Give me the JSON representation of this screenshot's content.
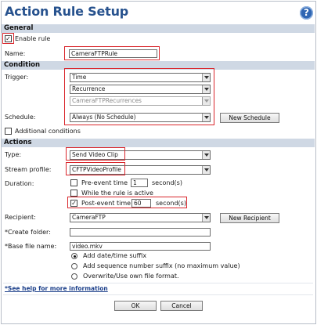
{
  "header": {
    "title": "Action Rule Setup",
    "help_glyph": "?"
  },
  "general": {
    "section_label": "General",
    "enable_rule_label": "Enable rule",
    "enable_rule_checked": true,
    "name_label": "Name:",
    "name_value": "CameraFTPRule"
  },
  "condition": {
    "section_label": "Condition",
    "trigger_label": "Trigger:",
    "trigger_value": "Time",
    "trigger_sub_value": "Recurrence",
    "recurrence_value": "CameraFTPRecurrences",
    "schedule_label": "Schedule:",
    "schedule_value": "Always (No Schedule)",
    "new_schedule_label": "New Schedule",
    "additional_conditions_label": "Additional conditions",
    "additional_conditions_checked": false
  },
  "actions": {
    "section_label": "Actions",
    "type_label": "Type:",
    "type_value": "Send Video Clip",
    "stream_profile_label": "Stream profile:",
    "stream_profile_value": "CFTPVideoProfile",
    "duration_label": "Duration:",
    "pre_event_label": "Pre-event time",
    "pre_event_checked": false,
    "pre_event_value": "1",
    "pre_event_unit": "second(s)",
    "while_active_label": "While the rule is active",
    "while_active_checked": false,
    "post_event_label": "Post-event time",
    "post_event_checked": true,
    "post_event_value": "60",
    "post_event_unit": "second(s)",
    "recipient_label": "Recipient:",
    "recipient_value": "CameraFTP",
    "new_recipient_label": "New Recipient",
    "create_folder_label": "*Create folder:",
    "create_folder_value": "",
    "base_file_name_label": "*Base file name:",
    "base_file_name_value": "video.mkv",
    "suffix_options": [
      {
        "label": "Add date/time suffix",
        "selected": true
      },
      {
        "label": "Add sequence number suffix (no maximum value)",
        "selected": false
      },
      {
        "label": "Overwrite/Use own file format.",
        "selected": false
      }
    ]
  },
  "footer": {
    "help_link_label": "*See help for more information",
    "ok_label": "OK",
    "cancel_label": "Cancel"
  },
  "colors": {
    "title": "#27528e",
    "section_bg": "#cfd8e4",
    "highlight": "#d9262c",
    "link": "#1b3f8a"
  }
}
